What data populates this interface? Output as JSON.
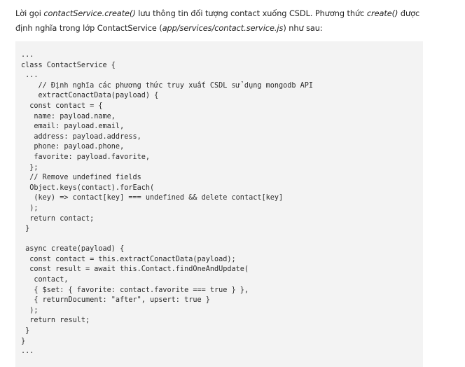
{
  "intro": {
    "t1": "Lời gọi ",
    "i1": "contactService.create()",
    "t2": " lưu thông tin đối tượng contact xuống CSDL. Phương thức ",
    "i2": "create()",
    "t3": " được định nghĩa trong lớp ContactService (",
    "i3": "app/services/contact.service.js",
    "t4": ") như sau:"
  },
  "code_lines": [
    "...",
    "class ContactService {",
    " ...",
    "    // Định nghĩa các phương thức truy xuất CSDL sử dụng mongodb API",
    "    extractConactData(payload) {",
    "  const contact = {",
    "   name: payload.name,",
    "   email: payload.email,",
    "   address: payload.address,",
    "   phone: payload.phone,",
    "   favorite: payload.favorite,",
    "  };",
    "  // Remove undefined fields",
    "  Object.keys(contact).forEach(",
    "   (key) => contact[key] === undefined && delete contact[key]",
    "  );",
    "  return contact;",
    " }",
    "",
    " async create(payload) {",
    "  const contact = this.extractConactData(payload);",
    "  const result = await this.Contact.findOneAndUpdate(",
    "   contact,",
    "   { $set: { favorite: contact.favorite === true } },",
    "   { returnDocument: \"after\", upsert: true }",
    "  );",
    "  return result;",
    " }",
    "}",
    "..."
  ]
}
